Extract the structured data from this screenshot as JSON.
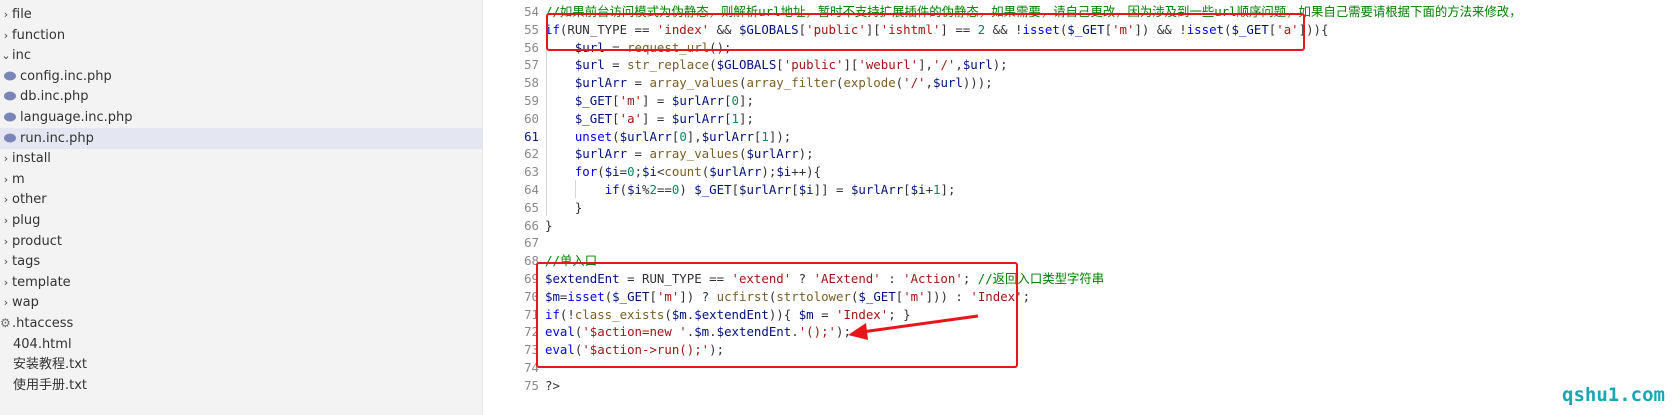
{
  "sidebar": {
    "items": [
      {
        "label": "file",
        "type": "folder"
      },
      {
        "label": "function",
        "type": "folder"
      },
      {
        "label": "inc",
        "type": "folder-open"
      },
      {
        "label": "config.inc.php",
        "type": "php"
      },
      {
        "label": "db.inc.php",
        "type": "php"
      },
      {
        "label": "language.inc.php",
        "type": "php"
      },
      {
        "label": "run.inc.php",
        "type": "php",
        "selected": true
      },
      {
        "label": "install",
        "type": "folder"
      },
      {
        "label": "m",
        "type": "folder"
      },
      {
        "label": "other",
        "type": "folder"
      },
      {
        "label": "plug",
        "type": "folder"
      },
      {
        "label": "product",
        "type": "folder"
      },
      {
        "label": "tags",
        "type": "folder"
      },
      {
        "label": "template",
        "type": "folder"
      },
      {
        "label": "wap",
        "type": "folder"
      },
      {
        "label": ".htaccess",
        "type": "config"
      },
      {
        "label": "404.html",
        "type": "file"
      },
      {
        "label": "安装教程.txt",
        "type": "file"
      },
      {
        "label": "使用手册.txt",
        "type": "file"
      }
    ]
  },
  "editor": {
    "active_line": "61",
    "lines": [
      {
        "n": "54",
        "code": "//如果前台访问模式为伪静态，则解析url地址，暂时不支持扩展插件的伪静态，如果需要，请自己更改，因为涉及到一些url顺序问题，如果自己需要请根据下面的方法来修改，"
      },
      {
        "n": "55",
        "code": "if(RUN_TYPE == 'index' && $GLOBALS['public']['ishtml'] == 2 && !isset($_GET['m']) && !isset($_GET['a'])){"
      },
      {
        "n": "56",
        "code": "    $url = request_url();"
      },
      {
        "n": "57",
        "code": "    $url = str_replace($GLOBALS['public']['weburl'],'/',$url);"
      },
      {
        "n": "58",
        "code": "    $urlArr = array_values(array_filter(explode('/',$url)));"
      },
      {
        "n": "59",
        "code": "    $_GET['m'] = $urlArr[0];"
      },
      {
        "n": "60",
        "code": "    $_GET['a'] = $urlArr[1];"
      },
      {
        "n": "61",
        "code": "    unset($urlArr[0],$urlArr[1]);"
      },
      {
        "n": "62",
        "code": "    $urlArr = array_values($urlArr);"
      },
      {
        "n": "63",
        "code": "    for($i=0;$i<count($urlArr);$i++){"
      },
      {
        "n": "64",
        "code": "        if($i%2==0) $_GET[$urlArr[$i]] = $urlArr[$i+1];"
      },
      {
        "n": "65",
        "code": "    }"
      },
      {
        "n": "66",
        "code": "}"
      },
      {
        "n": "67",
        "code": ""
      },
      {
        "n": "68",
        "code": "//单入口"
      },
      {
        "n": "69",
        "code": "$extendEnt = RUN_TYPE == 'extend' ? 'AExtend' : 'Action'; //返回入口类型字符串"
      },
      {
        "n": "70",
        "code": "$m=isset($_GET['m']) ? ucfirst(strtolower($_GET['m'])) : 'Index';"
      },
      {
        "n": "71",
        "code": "if(!class_exists($m.$extendEnt)){ $m = 'Index'; }"
      },
      {
        "n": "72",
        "code": "eval('$action=new '.$m.$extendEnt.'();');"
      },
      {
        "n": "73",
        "code": "eval('$action->run();');"
      },
      {
        "n": "74",
        "code": ""
      },
      {
        "n": "75",
        "code": "?>"
      }
    ]
  },
  "colors": {
    "annotation": "#e8151a",
    "watermark": "#19a7b4",
    "keyword": "#0000ff",
    "string": "#a31515",
    "variable": "#001080",
    "comment": "#008000"
  },
  "watermark": "qshu1.com"
}
